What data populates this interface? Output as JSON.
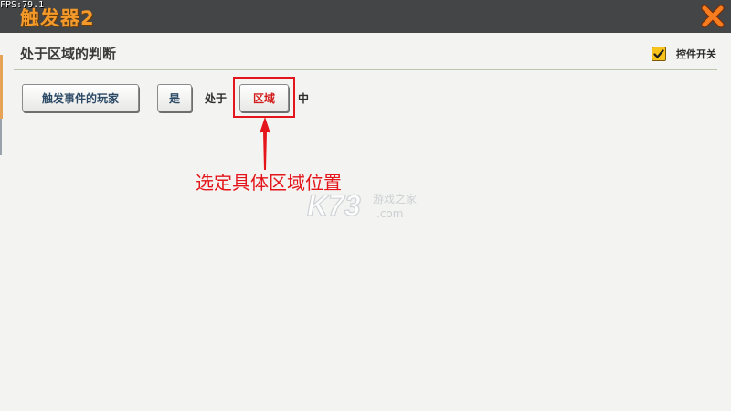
{
  "overlay": {
    "fps": "FPS:79.1"
  },
  "window": {
    "title": "触发器2",
    "close_icon": "close-x-icon",
    "accent_color": "#f39a2b",
    "close_color": "#f57c1f"
  },
  "section": {
    "title": "处于区域的判断"
  },
  "toggle": {
    "label": "控件开关",
    "checked": true,
    "color": "#f7c21a"
  },
  "condition": {
    "player_button": "触发事件的玩家",
    "yes_button": "是",
    "located_text": "处于",
    "region_button": "区域",
    "in_text": "中"
  },
  "annotation": {
    "text": "选定具体区域位置",
    "color": "#e4161b"
  },
  "watermark": {
    "logo": "K73",
    "cn": "游戏之家",
    "domain": ".com"
  }
}
